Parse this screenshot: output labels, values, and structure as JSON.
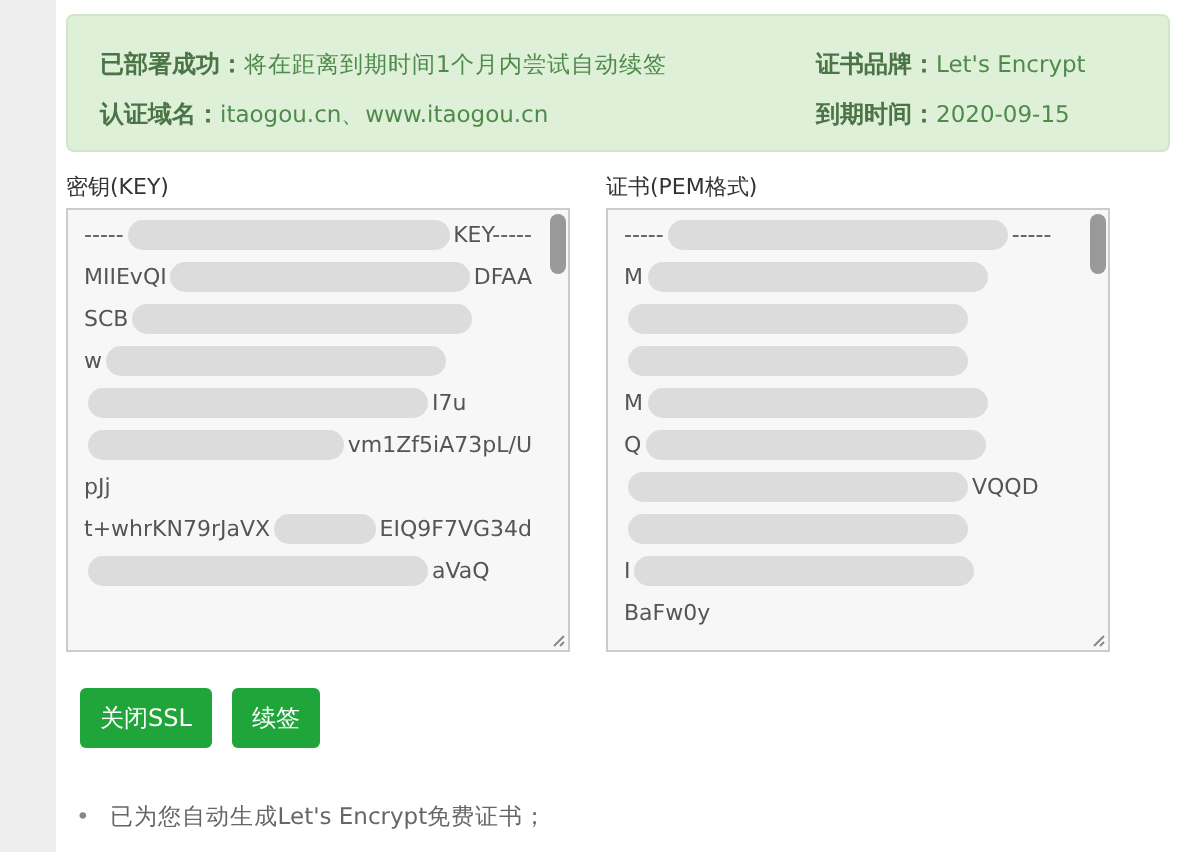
{
  "alert": {
    "rows": [
      {
        "label": "已部署成功：",
        "value": "将在距离到期时间1个月内尝试自动续签",
        "side_label": "证书品牌：",
        "side_value": "Let's Encrypt"
      },
      {
        "label": "认证域名：",
        "value": "itaogou.cn、www.itaogou.cn",
        "side_label": "到期时间：",
        "side_value": "2020-09-15"
      }
    ]
  },
  "fields": [
    {
      "label": "密钥(KEY)",
      "lines": [
        [
          {
            "kind": "text",
            "text": "-----"
          },
          {
            "kind": "redacted"
          },
          {
            "kind": "text",
            "text": "KEY-----"
          }
        ],
        [
          {
            "kind": "text",
            "text": "MIIEvQI"
          },
          {
            "kind": "redacted"
          },
          {
            "kind": "text",
            "text": "DFAA"
          }
        ],
        [
          {
            "kind": "text",
            "text": "SCB"
          },
          {
            "kind": "redacted"
          }
        ],
        [
          {
            "kind": "text",
            "text": "w"
          },
          {
            "kind": "redacted"
          }
        ],
        [
          {
            "kind": "redacted"
          },
          {
            "kind": "text",
            "text": "I7u"
          }
        ],
        [
          {
            "kind": "redacted"
          },
          {
            "kind": "text",
            "text": "vm1Zf5iA73pL/U"
          }
        ],
        [
          {
            "kind": "text",
            "text": "pJj"
          }
        ],
        [
          {
            "kind": "text",
            "text": "t+whrKN79rJaVX"
          },
          {
            "kind": "redacted"
          },
          {
            "kind": "text",
            "text": "EIQ9F7VG34d"
          }
        ],
        [
          {
            "kind": "redacted"
          },
          {
            "kind": "text",
            "text": "aVaQ"
          }
        ]
      ]
    },
    {
      "label": "证书(PEM格式)",
      "lines": [
        [
          {
            "kind": "text",
            "text": "-----"
          },
          {
            "kind": "redacted"
          },
          {
            "kind": "text",
            "text": "-----"
          }
        ],
        [
          {
            "kind": "text",
            "text": "M"
          },
          {
            "kind": "redacted"
          }
        ],
        [
          {
            "kind": "redacted"
          }
        ],
        [
          {
            "kind": "redacted"
          }
        ],
        [
          {
            "kind": "text",
            "text": "M"
          },
          {
            "kind": "redacted"
          }
        ],
        [
          {
            "kind": "text",
            "text": "Q"
          },
          {
            "kind": "redacted"
          }
        ],
        [
          {
            "kind": "redacted"
          },
          {
            "kind": "text",
            "text": "VQQD"
          }
        ],
        [
          {
            "kind": "redacted"
          }
        ],
        [
          {
            "kind": "text",
            "text": "I"
          },
          {
            "kind": "redacted"
          }
        ],
        [
          {
            "kind": "text",
            "text": "BaFw0y"
          }
        ]
      ]
    }
  ],
  "buttons": [
    "关闭SSL",
    "续签"
  ],
  "notes": [
    {
      "bullet": "•",
      "text": "已为您自动生成Let's Encrypt免费证书；"
    }
  ]
}
